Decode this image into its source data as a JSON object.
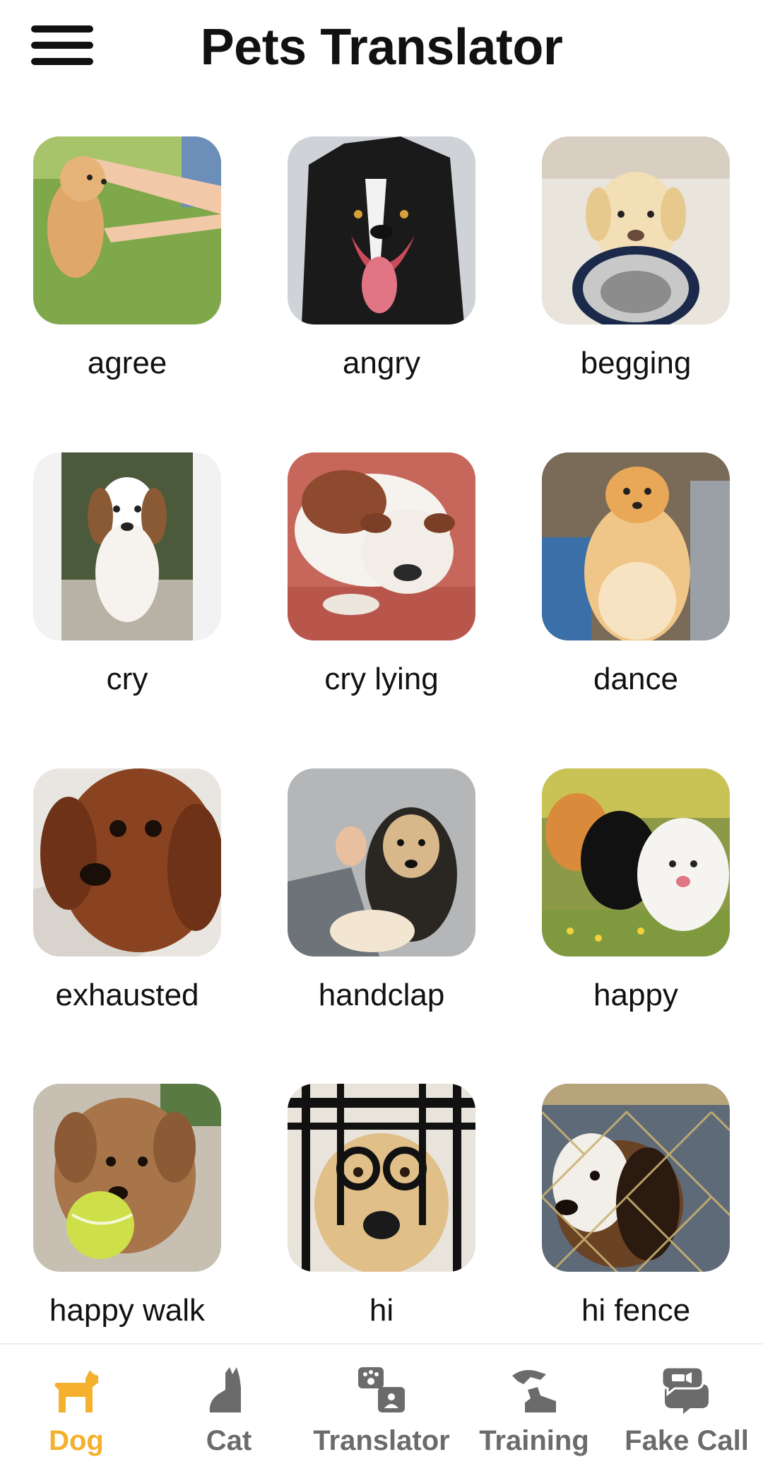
{
  "header": {
    "title": "Pets Translator",
    "menu_icon": "hamburger-menu-icon"
  },
  "items": [
    {
      "label": "agree"
    },
    {
      "label": "angry"
    },
    {
      "label": "begging"
    },
    {
      "label": "cry"
    },
    {
      "label": "cry lying"
    },
    {
      "label": "dance"
    },
    {
      "label": "exhausted"
    },
    {
      "label": "handclap"
    },
    {
      "label": "happy"
    },
    {
      "label": "happy walk"
    },
    {
      "label": "hi"
    },
    {
      "label": "hi fence"
    }
  ],
  "nav": {
    "items": [
      {
        "label": "Dog",
        "icon": "dog-icon",
        "active": true
      },
      {
        "label": "Cat",
        "icon": "cat-icon",
        "active": false
      },
      {
        "label": "Translator",
        "icon": "translator-icon",
        "active": false
      },
      {
        "label": "Training",
        "icon": "training-icon",
        "active": false
      },
      {
        "label": "Fake Call",
        "icon": "chat-bubbles-icon",
        "active": false
      }
    ],
    "active_color": "#f5b12e",
    "inactive_color": "#6b6b6b"
  }
}
